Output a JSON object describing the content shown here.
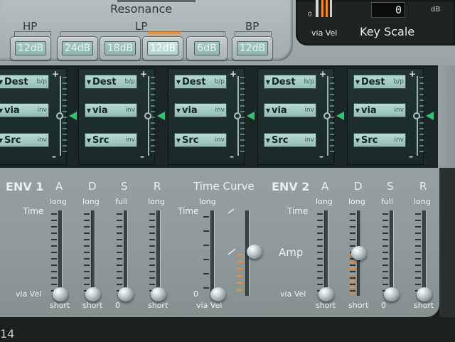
{
  "filter": {
    "resonance_label": "Resonance",
    "groups": {
      "hp": "HP",
      "lp": "LP",
      "bp": "BP"
    },
    "buttons": [
      {
        "label": "12dB",
        "active": false
      },
      {
        "label": "24dB",
        "active": false
      },
      {
        "label": "18dB",
        "active": false
      },
      {
        "label": "12dB",
        "active": true
      },
      {
        "label": "6dB",
        "active": false
      },
      {
        "label": "12dB",
        "active": false
      }
    ]
  },
  "key_scale": {
    "via_vel_label": "via Vel",
    "min_label": "0",
    "title": "Key Scale",
    "value": "0",
    "unit": "dB"
  },
  "mod_router": {
    "slots": [
      {
        "dest": "Dest",
        "dest_tag": "b/p",
        "via": "via",
        "via_tag": "inv",
        "src": "Src",
        "src_tag": "inv"
      },
      {
        "dest": "Dest",
        "dest_tag": "b/p",
        "via": "via",
        "via_tag": "inv",
        "src": "Src",
        "src_tag": "inv"
      },
      {
        "dest": "Dest",
        "dest_tag": "b/p",
        "via": "via",
        "via_tag": "inv",
        "src": "Src",
        "src_tag": "inv"
      },
      {
        "dest": "Dest",
        "dest_tag": "b/p",
        "via": "via",
        "via_tag": "inv",
        "src": "Src",
        "src_tag": "inv"
      },
      {
        "dest": "Dest",
        "dest_tag": "b/p",
        "via": "via",
        "via_tag": "inv",
        "src": "Src",
        "src_tag": "inv"
      }
    ],
    "plus": "+",
    "minus": "–"
  },
  "env1": {
    "title": "ENV 1",
    "time_label": "Time",
    "via_vel_label": "via Vel",
    "columns": [
      {
        "name": "A",
        "top": "long",
        "bottom": "short"
      },
      {
        "name": "D",
        "top": "long",
        "bottom": "short"
      },
      {
        "name": "S",
        "top": "full",
        "bottom": "0"
      },
      {
        "name": "R",
        "top": "long",
        "bottom": "short"
      }
    ]
  },
  "time_curve": {
    "title": "Time Curve",
    "time_label": "Time",
    "top": "long",
    "zero": "0",
    "bottom": "via Vel"
  },
  "env2": {
    "title": "ENV 2",
    "time_label": "Time",
    "via_vel_label": "via Vel",
    "amp_label": "Amp",
    "columns": [
      {
        "name": "A",
        "top": "long",
        "bottom": "short"
      },
      {
        "name": "D",
        "top": "long",
        "bottom": "short"
      },
      {
        "name": "S",
        "top": "full",
        "bottom": "0"
      },
      {
        "name": "R",
        "top": "long",
        "bottom": "short"
      }
    ]
  },
  "footer": {
    "text": "14"
  },
  "colors": {
    "accent_orange": "#ff8a1f",
    "route_green": "#27c96c",
    "lcd_text": "#d8f3dd"
  }
}
